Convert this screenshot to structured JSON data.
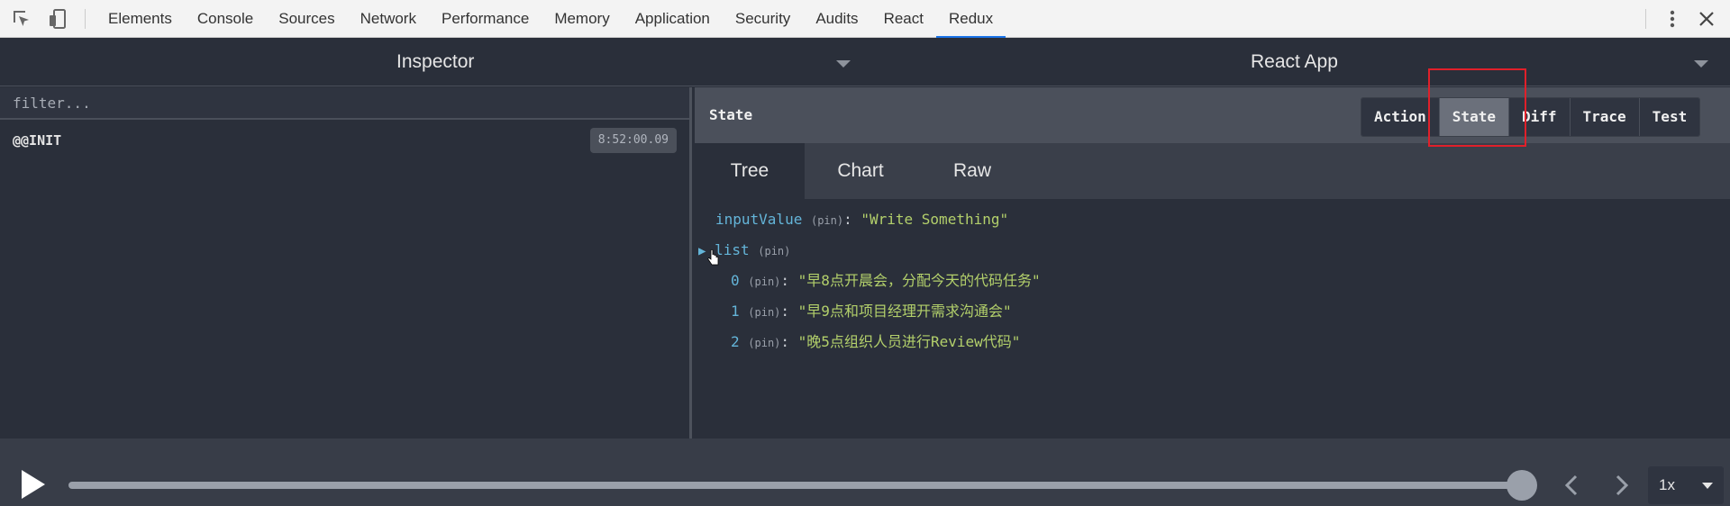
{
  "devtools": {
    "tabs": [
      "Elements",
      "Console",
      "Sources",
      "Network",
      "Performance",
      "Memory",
      "Application",
      "Security",
      "Audits",
      "React",
      "Redux"
    ],
    "active_tab": "Redux",
    "accent_color": "#1a73e8"
  },
  "header": {
    "inspector_title": "Inspector",
    "app_title": "React App"
  },
  "left_panel": {
    "filter_placeholder": "filter...",
    "actions": [
      {
        "name": "@@INIT",
        "time": "8:52:00.09"
      }
    ]
  },
  "right_panel": {
    "title": "State",
    "buttons": [
      "Action",
      "State",
      "Diff",
      "Trace",
      "Test"
    ],
    "active_button": "State",
    "highlight_color": "#e0202a",
    "sub_tabs": [
      "Tree",
      "Chart",
      "Raw"
    ],
    "active_sub_tab": "Tree",
    "tree": {
      "input_key": "inputValue",
      "pin": "(pin)",
      "input_value": "\"Write Something\"",
      "list_key": "list",
      "items": [
        {
          "index": "0",
          "value": "\"早8点开晨会，分配今天的代码任务\""
        },
        {
          "index": "1",
          "value": "\"早9点和项目经理开需求沟通会\""
        },
        {
          "index": "2",
          "value": "\"晚5点组织人员进行Review代码\""
        }
      ]
    }
  },
  "playback": {
    "speed": "1x",
    "progress": 1.0
  }
}
